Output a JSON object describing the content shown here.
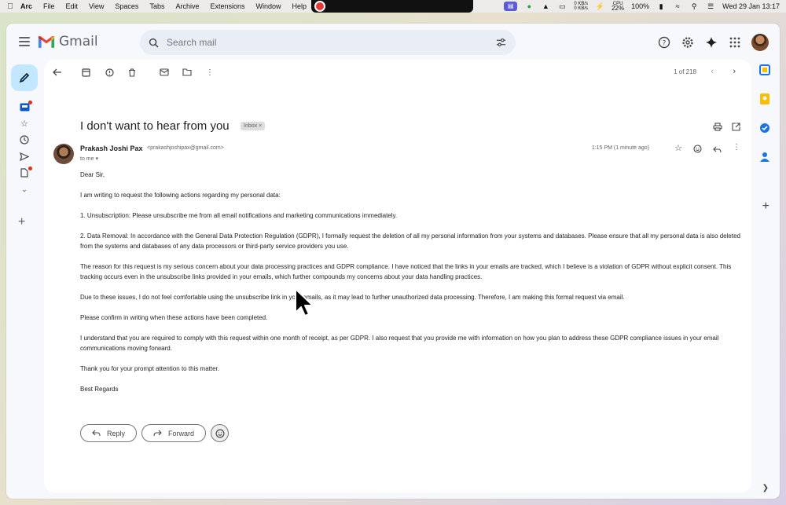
{
  "menubar": {
    "app": "Arc",
    "items": [
      "File",
      "Edit",
      "View",
      "Spaces",
      "Tabs",
      "Archive",
      "Extensions",
      "Window",
      "Help"
    ],
    "battery": "100%",
    "cpu_label": "CPU",
    "cpu": "22%",
    "net_up": "0 KB/s",
    "net_down": "0 KB/s",
    "datetime": "Wed 29 Jan  13:17"
  },
  "gmail": {
    "logo_text": "Gmail",
    "search_placeholder": "Search mail"
  },
  "toolbar": {
    "counter": "1 of 218"
  },
  "email": {
    "subject": "I don't want to hear from you",
    "label": "Inbox",
    "sender_name": "Prakash Joshi Pax",
    "sender_email": "<prakashjoshipax@gmail.com>",
    "to": "to me",
    "timestamp": "1:15 PM (1 minute ago)",
    "paragraphs": [
      "Dear Sir,",
      "I am writing to request the following actions regarding my personal data:",
      "1. Unsubscription: Please unsubscribe me from all email notifications and marketing communications immediately.",
      "2. Data Removal: In accordance with the General Data Protection Regulation (GDPR), I formally request the deletion of all my personal information from your systems and databases. Please ensure that all my personal data is also deleted from the systems and databases of any data processors or third-party service providers you use.",
      "The reason for this request is my serious concern about your data processing practices and GDPR compliance. I have noticed that the links in your emails are tracked, which I believe is a violation of GDPR without explicit consent. This tracking occurs even in the unsubscribe links provided in your emails, which further compounds my concerns about your data handling practices.",
      "Due to these issues, I do not feel comfortable using the unsubscribe link in your emails, as it may lead to further unauthorized data processing. Therefore, I am making this formal request via email.",
      "Please confirm in writing when these actions have been completed.",
      "I understand that you are required to comply with this request within one month of receipt, as per GDPR. I also request that you provide me with information on how you plan to address these GDPR compliance issues in your email communications moving forward.",
      "Thank you for your prompt attention to this matter.",
      "Best Regards"
    ]
  },
  "actions": {
    "reply": "Reply",
    "forward": "Forward"
  },
  "colors": {
    "accent": "#0b57d0",
    "compose_bg": "#c2e7ff",
    "gmail_red": "#ea4335"
  }
}
